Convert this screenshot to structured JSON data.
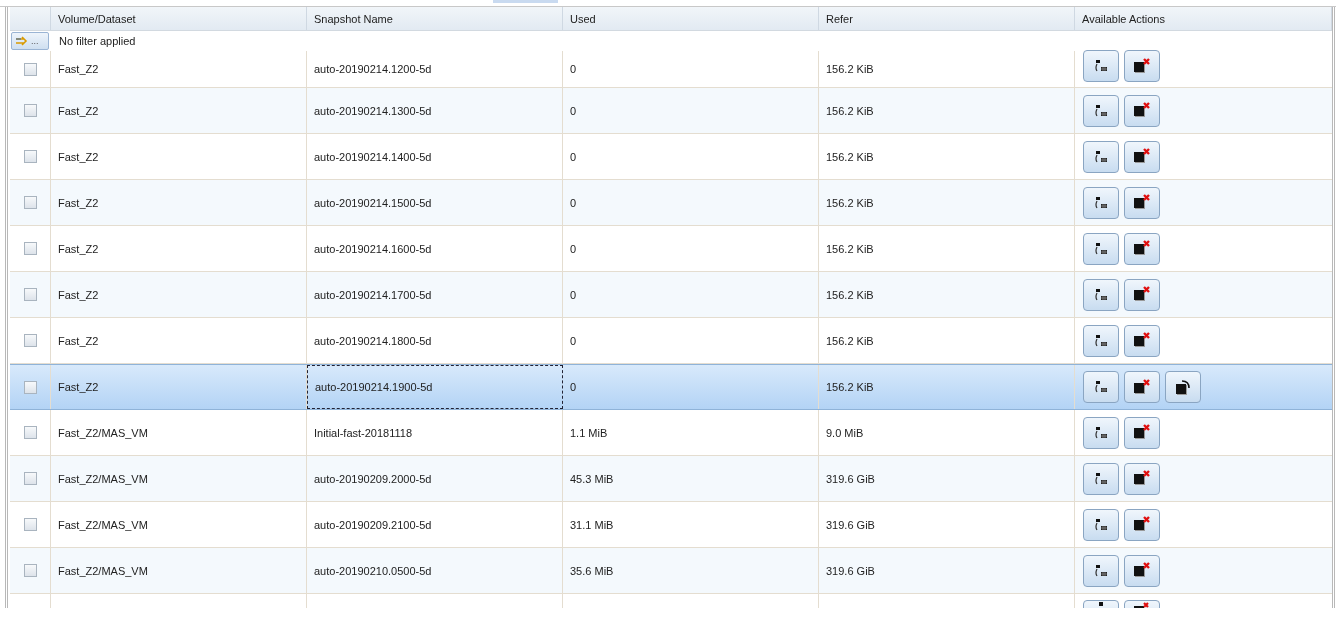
{
  "columns": [
    "Volume/Dataset",
    "Snapshot Name",
    "Used",
    "Refer",
    "Available Actions"
  ],
  "filter": {
    "button": "...",
    "text": "No filter applied"
  },
  "rows": [
    {
      "dataset": "Fast_Z2",
      "snapshot": "auto-20190214.1200-5d",
      "used": "0",
      "refer": "156.2 KiB",
      "checked": false,
      "selected": false,
      "focused": false,
      "actions": [
        {
          "kind": "clone"
        },
        {
          "kind": "delete"
        }
      ]
    },
    {
      "dataset": "Fast_Z2",
      "snapshot": "auto-20190214.1300-5d",
      "used": "0",
      "refer": "156.2 KiB",
      "checked": false,
      "selected": false,
      "focused": false,
      "actions": [
        {
          "kind": "clone"
        },
        {
          "kind": "delete"
        }
      ]
    },
    {
      "dataset": "Fast_Z2",
      "snapshot": "auto-20190214.1400-5d",
      "used": "0",
      "refer": "156.2 KiB",
      "checked": false,
      "selected": false,
      "focused": false,
      "actions": [
        {
          "kind": "clone"
        },
        {
          "kind": "delete"
        }
      ]
    },
    {
      "dataset": "Fast_Z2",
      "snapshot": "auto-20190214.1500-5d",
      "used": "0",
      "refer": "156.2 KiB",
      "checked": false,
      "selected": false,
      "focused": false,
      "actions": [
        {
          "kind": "clone"
        },
        {
          "kind": "delete"
        }
      ]
    },
    {
      "dataset": "Fast_Z2",
      "snapshot": "auto-20190214.1600-5d",
      "used": "0",
      "refer": "156.2 KiB",
      "checked": false,
      "selected": false,
      "focused": false,
      "actions": [
        {
          "kind": "clone"
        },
        {
          "kind": "delete"
        }
      ]
    },
    {
      "dataset": "Fast_Z2",
      "snapshot": "auto-20190214.1700-5d",
      "used": "0",
      "refer": "156.2 KiB",
      "checked": false,
      "selected": false,
      "focused": false,
      "actions": [
        {
          "kind": "clone"
        },
        {
          "kind": "delete"
        }
      ]
    },
    {
      "dataset": "Fast_Z2",
      "snapshot": "auto-20190214.1800-5d",
      "used": "0",
      "refer": "156.2 KiB",
      "checked": false,
      "selected": false,
      "focused": false,
      "actions": [
        {
          "kind": "clone"
        },
        {
          "kind": "delete"
        }
      ]
    },
    {
      "dataset": "Fast_Z2",
      "snapshot": "auto-20190214.1900-5d",
      "used": "0",
      "refer": "156.2 KiB",
      "checked": false,
      "selected": true,
      "focused": true,
      "actions": [
        {
          "kind": "clone"
        },
        {
          "kind": "delete"
        },
        {
          "kind": "rollback"
        }
      ]
    },
    {
      "dataset": "Fast_Z2/MAS_VM",
      "snapshot": "Initial-fast-20181118",
      "used": "1.1 MiB",
      "refer": "9.0 MiB",
      "checked": false,
      "selected": false,
      "focused": false,
      "actions": [
        {
          "kind": "clone"
        },
        {
          "kind": "delete"
        }
      ]
    },
    {
      "dataset": "Fast_Z2/MAS_VM",
      "snapshot": "auto-20190209.2000-5d",
      "used": "45.3 MiB",
      "refer": "319.6 GiB",
      "checked": false,
      "selected": false,
      "focused": false,
      "actions": [
        {
          "kind": "clone"
        },
        {
          "kind": "delete"
        }
      ]
    },
    {
      "dataset": "Fast_Z2/MAS_VM",
      "snapshot": "auto-20190209.2100-5d",
      "used": "31.1 MiB",
      "refer": "319.6 GiB",
      "checked": false,
      "selected": false,
      "focused": false,
      "actions": [
        {
          "kind": "clone"
        },
        {
          "kind": "delete"
        }
      ]
    },
    {
      "dataset": "Fast_Z2/MAS_VM",
      "snapshot": "auto-20190210.0500-5d",
      "used": "35.6 MiB",
      "refer": "319.6 GiB",
      "checked": false,
      "selected": false,
      "focused": false,
      "actions": [
        {
          "kind": "clone"
        },
        {
          "kind": "delete"
        }
      ]
    }
  ],
  "partial_row": {
    "actions": [
      {
        "kind": "clone"
      },
      {
        "kind": "delete"
      }
    ]
  }
}
